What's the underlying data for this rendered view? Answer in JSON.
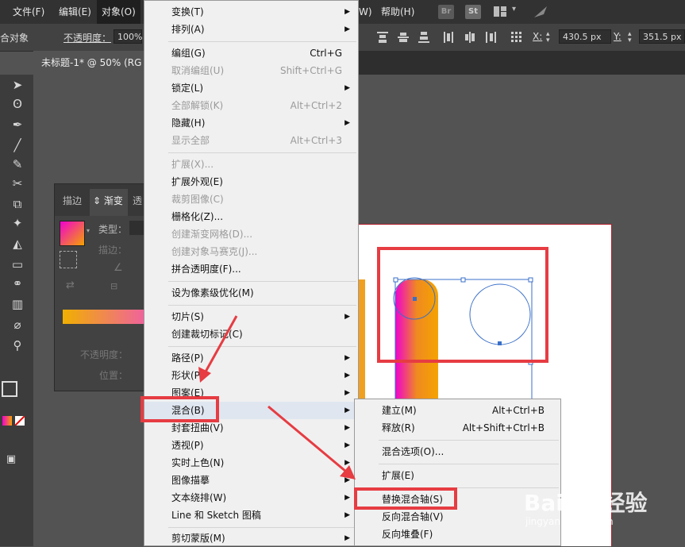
{
  "menubar": {
    "items": [
      {
        "label": "文件(F)"
      },
      {
        "label": "编辑(E)"
      },
      {
        "label": "对象(O)"
      },
      {
        "label": "W)"
      },
      {
        "label": "帮助(H)"
      }
    ],
    "app_icons": [
      "Br",
      "St"
    ]
  },
  "control_bar": {
    "left_label": "合对象",
    "opacity_label": "不透明度：",
    "opacity_value": "100%",
    "x_label": "X:",
    "x_value": "430.5 px",
    "y_label": "Y:",
    "y_value": "351.5 px"
  },
  "document_tab": {
    "title": "未标题-1* @ 50% (RG"
  },
  "gradient_panel": {
    "tab_stroke": "描边",
    "tab_gradient": "渐变",
    "tab_third": "透",
    "type_label": "类型：",
    "stroke_label": "描边：",
    "opacity_label": "不透明度：",
    "position_label": "位置："
  },
  "object_menu": {
    "items": [
      {
        "label": "变换(T)",
        "shortcut": "",
        "submenu": true,
        "disabled": false
      },
      {
        "label": "排列(A)",
        "shortcut": "",
        "submenu": true,
        "disabled": false
      },
      {
        "label": "编组(G)",
        "shortcut": "Ctrl+G",
        "submenu": false,
        "disabled": false
      },
      {
        "label": "取消编组(U)",
        "shortcut": "Shift+Ctrl+G",
        "submenu": false,
        "disabled": true
      },
      {
        "label": "锁定(L)",
        "shortcut": "",
        "submenu": true,
        "disabled": false
      },
      {
        "label": "全部解锁(K)",
        "shortcut": "Alt+Ctrl+2",
        "submenu": false,
        "disabled": true
      },
      {
        "label": "隐藏(H)",
        "shortcut": "",
        "submenu": true,
        "disabled": false
      },
      {
        "label": "显示全部",
        "shortcut": "Alt+Ctrl+3",
        "submenu": false,
        "disabled": true
      },
      {
        "label": "扩展(X)...",
        "shortcut": "",
        "submenu": false,
        "disabled": true
      },
      {
        "label": "扩展外观(E)",
        "shortcut": "",
        "submenu": false,
        "disabled": false
      },
      {
        "label": "裁剪图像(C)",
        "shortcut": "",
        "submenu": false,
        "disabled": true
      },
      {
        "label": "栅格化(Z)...",
        "shortcut": "",
        "submenu": false,
        "disabled": false
      },
      {
        "label": "创建渐变网格(D)...",
        "shortcut": "",
        "submenu": false,
        "disabled": true
      },
      {
        "label": "创建对象马赛克(J)...",
        "shortcut": "",
        "submenu": false,
        "disabled": true
      },
      {
        "label": "拼合透明度(F)...",
        "shortcut": "",
        "submenu": false,
        "disabled": false
      },
      {
        "label": "设为像素级优化(M)",
        "shortcut": "",
        "submenu": false,
        "disabled": false
      },
      {
        "label": "切片(S)",
        "shortcut": "",
        "submenu": true,
        "disabled": false
      },
      {
        "label": "创建裁切标记(C)",
        "shortcut": "",
        "submenu": false,
        "disabled": false
      },
      {
        "label": "路径(P)",
        "shortcut": "",
        "submenu": true,
        "disabled": false
      },
      {
        "label": "形状(P)",
        "shortcut": "",
        "submenu": true,
        "disabled": false
      },
      {
        "label": "图案(E)",
        "shortcut": "",
        "submenu": true,
        "disabled": false
      },
      {
        "label": "混合(B)",
        "shortcut": "",
        "submenu": true,
        "disabled": false
      },
      {
        "label": "封套扭曲(V)",
        "shortcut": "",
        "submenu": true,
        "disabled": false
      },
      {
        "label": "透视(P)",
        "shortcut": "",
        "submenu": true,
        "disabled": false
      },
      {
        "label": "实时上色(N)",
        "shortcut": "",
        "submenu": true,
        "disabled": false
      },
      {
        "label": "图像描摹",
        "shortcut": "",
        "submenu": true,
        "disabled": false
      },
      {
        "label": "文本绕排(W)",
        "shortcut": "",
        "submenu": true,
        "disabled": false
      },
      {
        "label": "Line 和 Sketch 图稿",
        "shortcut": "",
        "submenu": true,
        "disabled": false
      },
      {
        "label": "剪切蒙版(M)",
        "shortcut": "",
        "submenu": true,
        "disabled": false
      }
    ]
  },
  "blend_submenu": {
    "items": [
      {
        "label": "建立(M)",
        "shortcut": "Alt+Ctrl+B"
      },
      {
        "label": "释放(R)",
        "shortcut": "Alt+Shift+Ctrl+B"
      },
      {
        "label": "混合选项(O)...",
        "shortcut": ""
      },
      {
        "label": "扩展(E)",
        "shortcut": ""
      },
      {
        "label": "替换混合轴(S)",
        "shortcut": ""
      },
      {
        "label": "反向混合轴(V)",
        "shortcut": ""
      },
      {
        "label": "反向堆叠(F)",
        "shortcut": ""
      }
    ]
  },
  "watermark": {
    "brand": "Baidu 经验",
    "url": "jingyan.baidu.com"
  },
  "colors": {
    "highlight": "#e63c42",
    "gradient_start": "#f000d0",
    "gradient_end": "#f5a300"
  }
}
